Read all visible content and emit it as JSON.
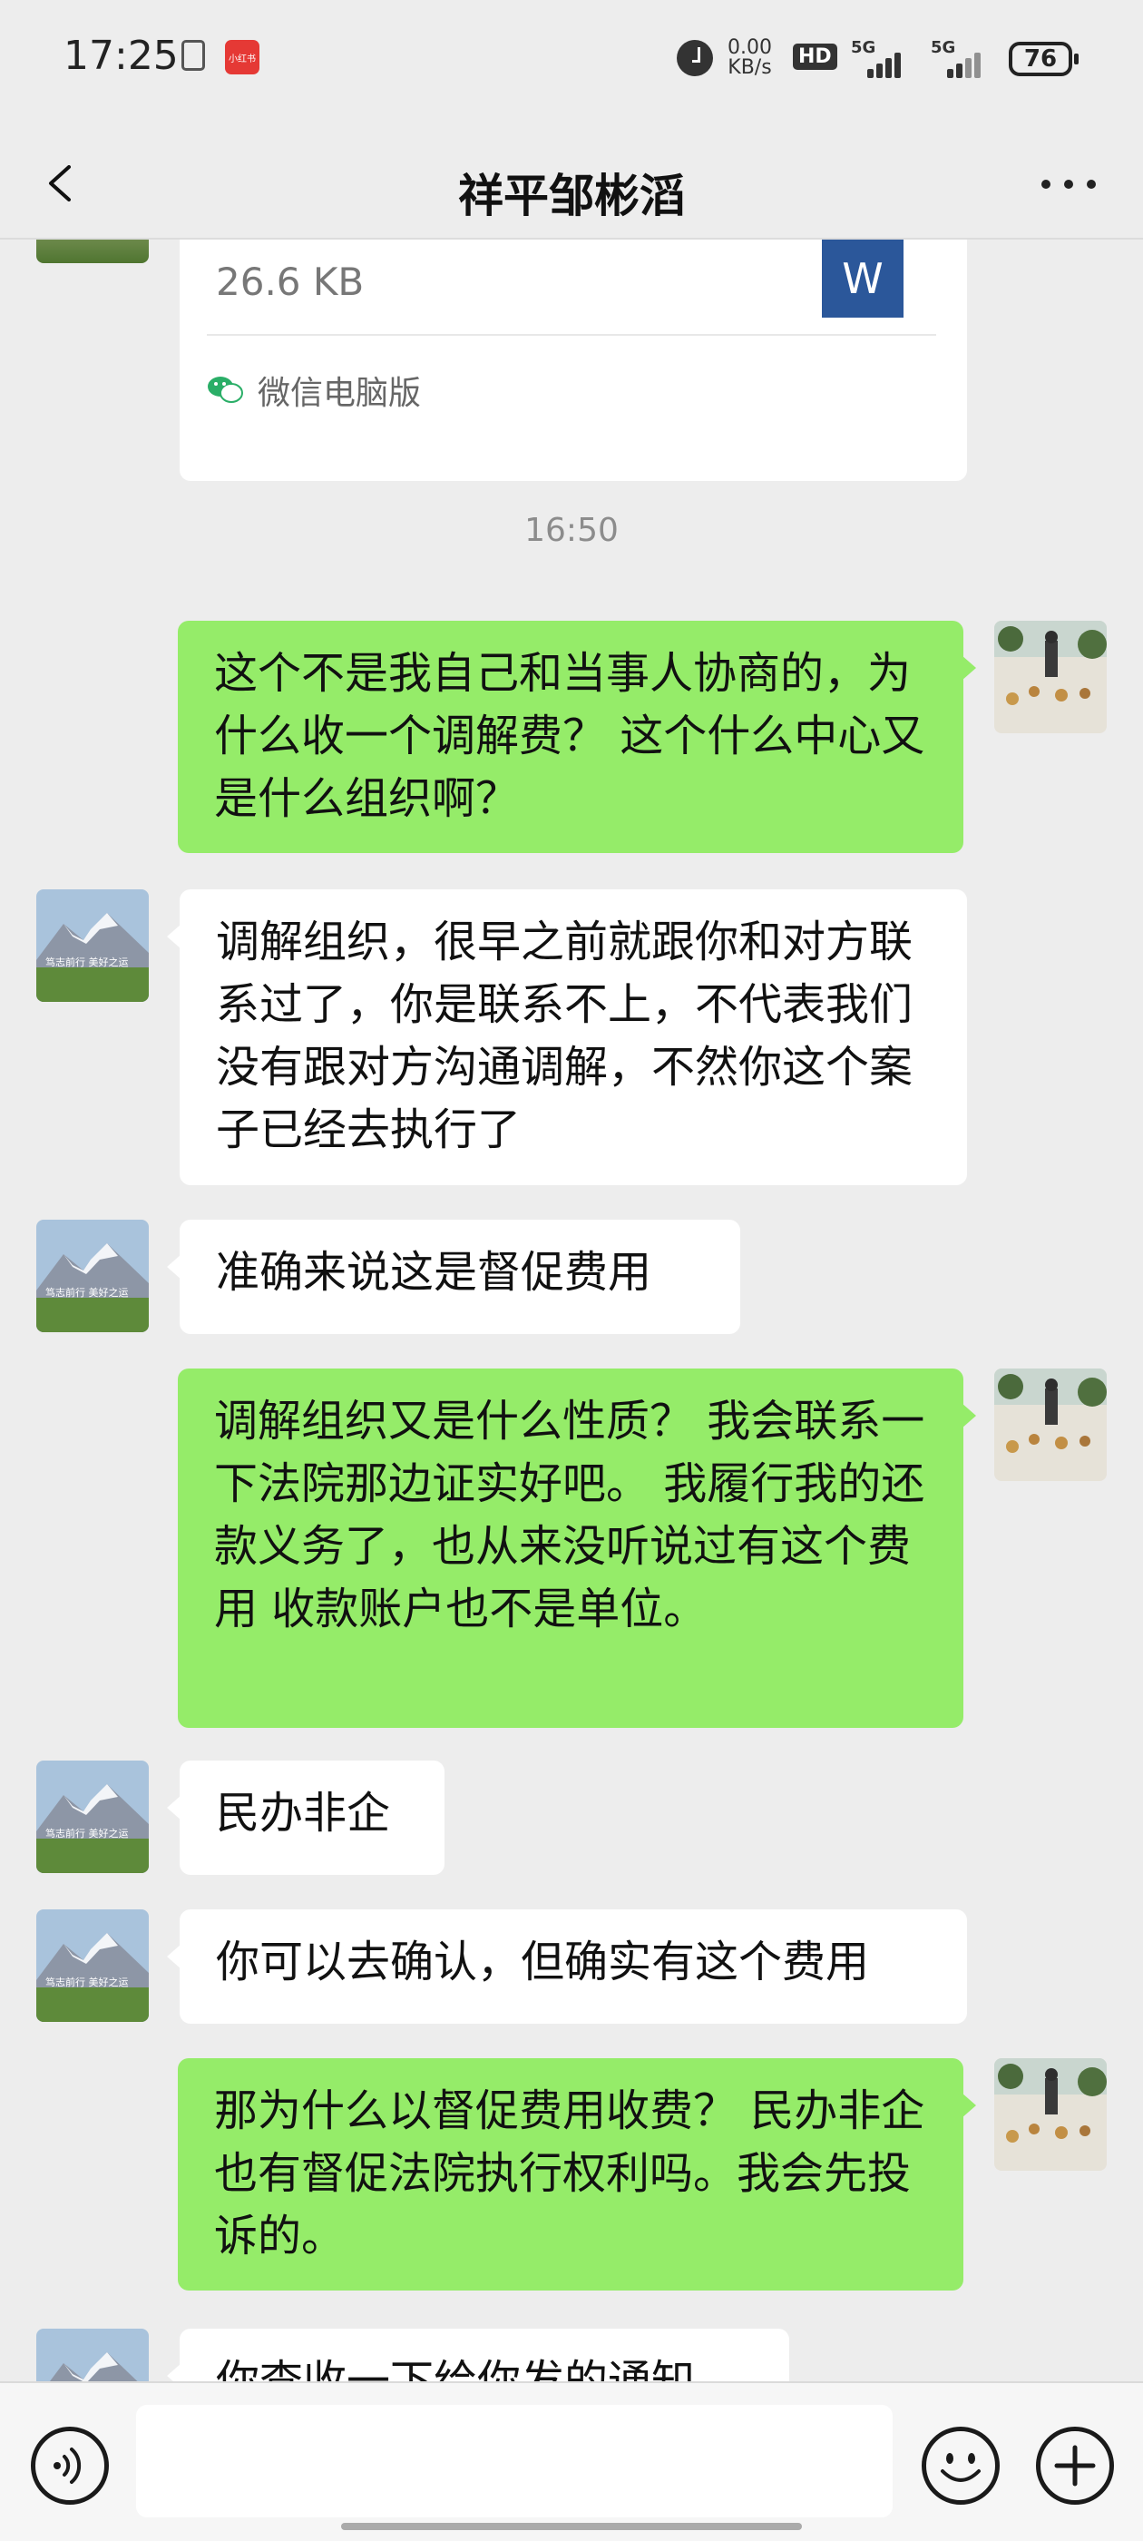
{
  "status_bar": {
    "time": "17:25",
    "app_badge": "小红书",
    "net_speed_value": "0.00",
    "net_speed_unit": "KB/s",
    "hd_label": "HD",
    "signal1_label": "5G",
    "signal2_label": "5G",
    "battery": "76"
  },
  "header": {
    "title": "祥平邹彬滔"
  },
  "file_card": {
    "size": "26.6 KB",
    "file_icon_letter": "W",
    "source": "微信电脑版"
  },
  "timestamp": "16:50",
  "messages": [
    {
      "side": "right",
      "text": "这个不是我自己和当事人协商的，为什么收一个调解费？ 这个什么中心又是什么组织啊？"
    },
    {
      "side": "left",
      "text": "调解组织，很早之前就跟你和对方联系过了，你是联系不上，不代表我们没有跟对方沟通调解，不然你这个案子已经去执行了"
    },
    {
      "side": "left",
      "text": "准确来说这是督促费用"
    },
    {
      "side": "right",
      "text": "调解组织又是什么性质？ 我会联系一下法院那边证实好吧。 我履行我的还款义务了，也从来没听说过有这个费用 收款账户也不是单位。"
    },
    {
      "side": "left",
      "text": "民办非企"
    },
    {
      "side": "left",
      "text": "你可以去确认，但确实有这个费用"
    },
    {
      "side": "right",
      "text": "那为什么以督促费用收费？ 民办非企 也有督促法院执行权利吗。我会先投诉的。"
    },
    {
      "side": "left",
      "text": "你查收一下给你发的通知"
    }
  ],
  "avatar_captions": {
    "contact_caption": "笃志前行 美好之运"
  },
  "colors": {
    "background": "#ededed",
    "outgoing_bubble": "#95ec69",
    "incoming_bubble": "#ffffff",
    "word_icon": "#2b579a"
  }
}
